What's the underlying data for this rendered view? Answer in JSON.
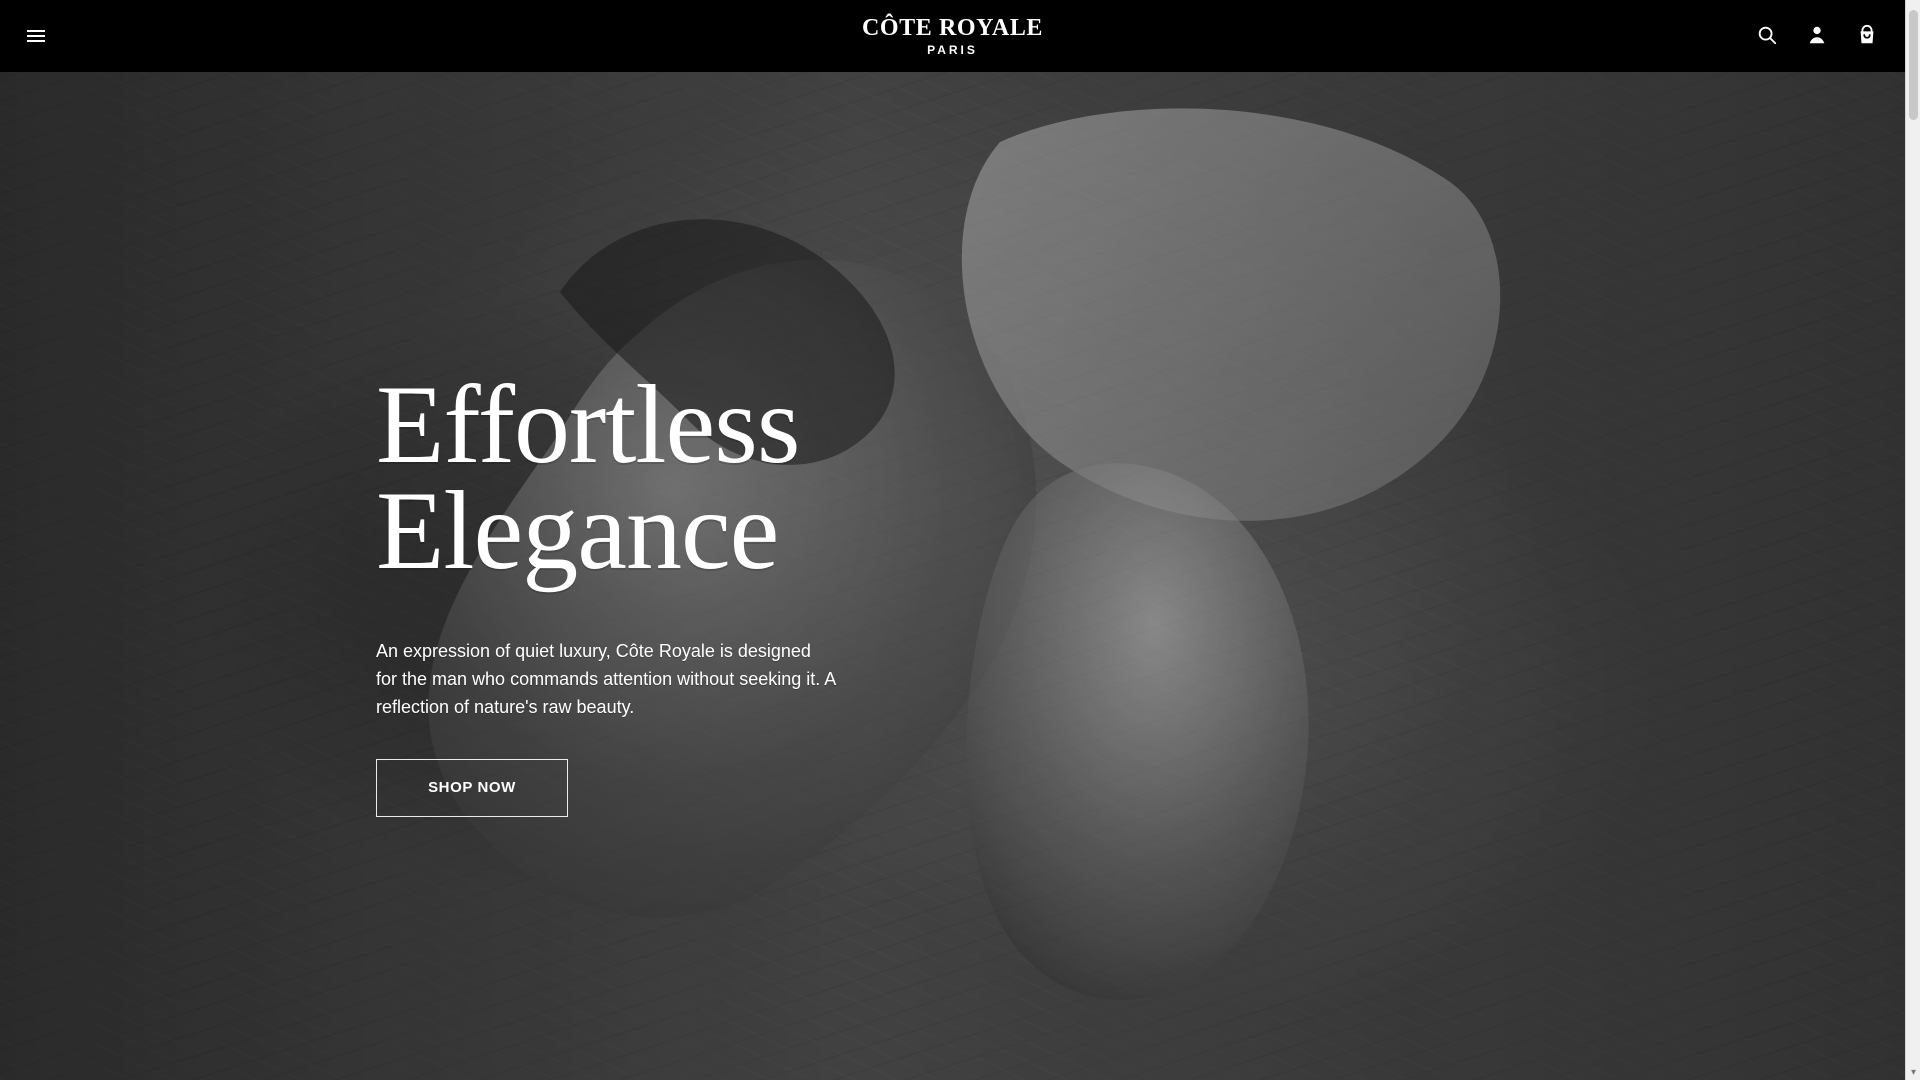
{
  "header": {
    "brand_name": "CÔTE ROYALE",
    "brand_sub": "PARIS",
    "icons": {
      "menu": "menu-icon",
      "search": "search-icon",
      "account": "user-icon",
      "cart": "bag-icon"
    }
  },
  "hero": {
    "title_line1": "Effortless",
    "title_line2": "Elegance",
    "body": "An expression of quiet luxury, Côte Royale is designed for the man who commands attention without seeking it. A reflection of nature's raw beauty.",
    "cta_label": "SHOP NOW"
  },
  "theme": {
    "header_bg": "#000000",
    "text_color": "#ffffff"
  },
  "scrollbar": {
    "down_arrow": "▾"
  }
}
